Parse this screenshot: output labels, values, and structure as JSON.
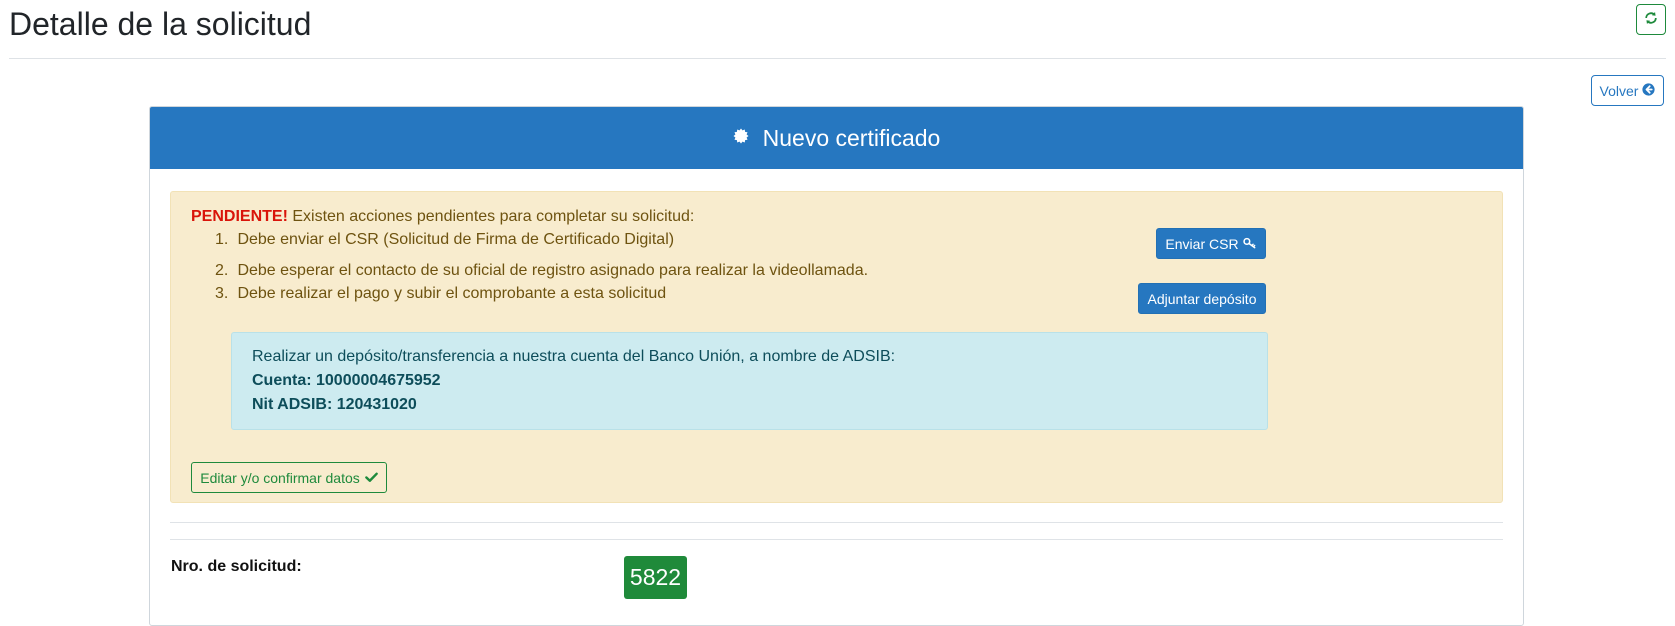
{
  "page": {
    "title": "Detalle de la solicitud",
    "refresh_icon": "refresh-icon",
    "back_label": "Volver",
    "back_icon": "arrow-circle-left-icon"
  },
  "card": {
    "title": "Nuevo certificado",
    "title_icon": "certificate-icon",
    "header_color": "#2677c0"
  },
  "alert": {
    "strong": "PENDIENTE!",
    "message": "Existen acciones pendientes para completar su solicitud:",
    "steps": [
      {
        "num": "1.",
        "text": "Debe enviar el CSR (Solicitud de Firma de Certificado Digital)"
      },
      {
        "num": "2.",
        "text": "Debe esperar el contacto de su oficial de registro asignado para realizar la videollamada."
      },
      {
        "num": "3.",
        "text": "Debe realizar el pago y subir el comprobante a esta solicitud"
      }
    ],
    "send_csr_label": "Enviar CSR",
    "send_csr_icon": "key-icon",
    "attach_deposit_label": "Adjuntar depósito",
    "deposit_info": {
      "line1": "Realizar un depósito/transferencia a nuestra cuenta del Banco Unión, a nombre de ADSIB:",
      "account": "Cuenta: 10000004675952",
      "nit": "Nit ADSIB: 120431020"
    },
    "edit_confirm_label": "Editar y/o confirmar datos",
    "edit_confirm_icon": "check-icon"
  },
  "details": {
    "request_number_label": "Nro. de solicitud:",
    "request_number": "5822"
  },
  "colors": {
    "primary": "#2677c0",
    "success": "#1e8a3c",
    "warning_bg": "#f8ecce",
    "info_bg": "#cdebf0",
    "danger_text": "#d9140a"
  }
}
